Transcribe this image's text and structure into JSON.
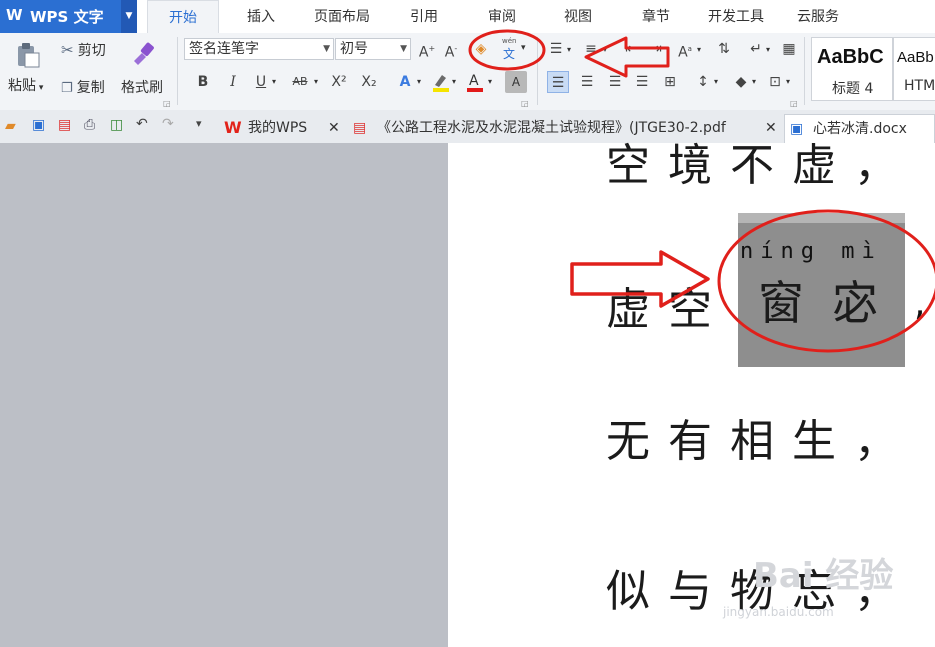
{
  "app": {
    "logo": "W",
    "title": "WPS 文字"
  },
  "tabs": [
    {
      "label": "开始",
      "active": true
    },
    {
      "label": "插入"
    },
    {
      "label": "页面布局"
    },
    {
      "label": "引用"
    },
    {
      "label": "审阅"
    },
    {
      "label": "视图"
    },
    {
      "label": "章节"
    },
    {
      "label": "开发工具"
    },
    {
      "label": "云服务"
    }
  ],
  "ribbon": {
    "paste": "粘贴",
    "cut": "剪切",
    "copy": "复制",
    "format_painter": "格式刷",
    "font_name": "签名连笔字",
    "font_size": "初号",
    "phonetic_glyph": "文",
    "phonetic_small": "wén",
    "bold": "B",
    "italic": "I",
    "underline": "U",
    "strike": "AB",
    "superscript": "X²",
    "subscript": "X₂",
    "styles": [
      {
        "preview": "AaBbC",
        "name": "标题 4"
      },
      {
        "preview": "AaBb",
        "name": "HTM"
      }
    ]
  },
  "doc_tabs": [
    {
      "label": "我的WPS"
    },
    {
      "label": "《公路工程水泥及水泥混凝土试验规程》(JTGE30-2.pdf"
    },
    {
      "label": "心若冰清.docx"
    }
  ],
  "document": {
    "lines": [
      "空境不虚，",
      "虚空",
      "无有相生，",
      "似与物忘，"
    ],
    "selected_chars": "窗宓",
    "pinyin": "níng mì"
  },
  "watermark": {
    "text": "Bai 经验",
    "url": "jingyan.baidu.com"
  },
  "colors": {
    "accent": "#2b6fd2",
    "annotation": "#e0201b",
    "selection": "#8e8e8e"
  }
}
